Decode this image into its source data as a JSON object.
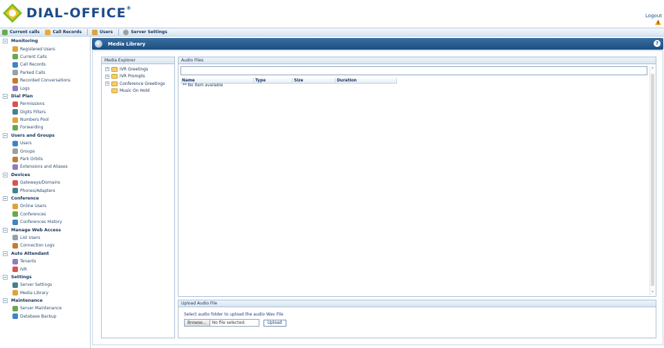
{
  "app": {
    "logo_text": "DIAL-OFFICE",
    "logo_mark": "®",
    "logout_label": "Logout"
  },
  "toolbar": {
    "items": [
      {
        "label": "Current calls",
        "icon": "phone-icon"
      },
      {
        "label": "Call Records",
        "icon": "call-records-icon"
      },
      {
        "label": "Users",
        "icon": "users-icon"
      },
      {
        "label": "Server Settings",
        "icon": "gear-icon"
      }
    ]
  },
  "sidebar": {
    "sections": [
      {
        "title": "Monitoring",
        "items": [
          "Registered Users",
          "Current Calls",
          "Call Records",
          "Parked Calls",
          "Recorded Conversations",
          "Logs"
        ]
      },
      {
        "title": "Dial Plan",
        "items": [
          "Permissions",
          "Digits Filters",
          "Numbers Pool",
          "Forwarding"
        ]
      },
      {
        "title": "Users and Groups",
        "items": [
          "Users",
          "Groups",
          "Park Orbits",
          "Extensions and Aliases"
        ]
      },
      {
        "title": "Devices",
        "items": [
          "Gateways/Domains",
          "Phones/Adapters"
        ]
      },
      {
        "title": "Conference",
        "items": [
          "Online Users",
          "Conferences",
          "Conferences History"
        ]
      },
      {
        "title": "Manage Web Access",
        "items": [
          "List Users",
          "Connection Logs"
        ]
      },
      {
        "title": "Auto Attendant",
        "items": [
          "Tenants",
          "IVR"
        ]
      },
      {
        "title": "Settings",
        "items": [
          "Server Settings",
          "Media Library"
        ]
      },
      {
        "title": "Maintenance",
        "items": [
          "Server Maintenance",
          "Database Backup"
        ]
      }
    ]
  },
  "main": {
    "title": "Media Library",
    "help_label": "?",
    "explorer": {
      "header": "Media Explorer",
      "folders": [
        {
          "label": "IVR Greetings",
          "expandable": true
        },
        {
          "label": "IVR Prompts",
          "expandable": true
        },
        {
          "label": "Conference Greetings",
          "expandable": true
        },
        {
          "label": "Music On Hold",
          "expandable": false
        }
      ]
    },
    "audio": {
      "header": "Audio Files",
      "search_value": "",
      "columns": [
        "Name",
        "Type",
        "Size",
        "Duration"
      ],
      "empty_text": "** No item available"
    },
    "upload": {
      "header": "Upload Audio File",
      "instruction": "Select audio folder to upload the audio Wav File",
      "browse_label": "Browse...",
      "file_label": "No file selected.",
      "upload_label": "Upload"
    }
  },
  "colors": {
    "brand": "#1a4c8b",
    "titlebar": "#1c4d80",
    "border": "#a9c0d8",
    "accent_orange": "#f39c12"
  }
}
